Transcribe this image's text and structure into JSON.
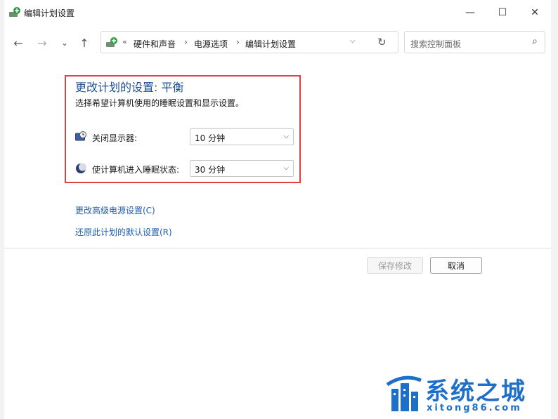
{
  "window": {
    "title": "编辑计划设置",
    "controls": {
      "minimize": "—",
      "maximize": "☐",
      "close": "✕"
    }
  },
  "nav": {
    "back": "←",
    "forward": "→",
    "recent": "⌄",
    "up": "↑",
    "address": {
      "overflow": "«",
      "crumbs": [
        "硬件和声音",
        "电源选项",
        "编辑计划设置"
      ],
      "separator": "›",
      "dropdown": "⌵",
      "refresh": "↻"
    },
    "search": {
      "placeholder": "搜索控制面板",
      "icon": "⌕"
    }
  },
  "plan": {
    "heading": "更改计划的设置: 平衡",
    "description": "选择希望计算机使用的睡眠设置和显示设置。",
    "settings": [
      {
        "icon": "display-clock-icon",
        "label": "关闭显示器:",
        "value": "10 分钟"
      },
      {
        "icon": "moon-icon",
        "label": "使计算机进入睡眠状态:",
        "value": "30 分钟"
      }
    ],
    "dropdown_arrow": "⌵"
  },
  "links": {
    "advanced": "更改高级电源设置(C)",
    "restore": "还原此计划的默认设置(R)"
  },
  "buttons": {
    "save": "保存修改",
    "cancel": "取消"
  },
  "watermark": {
    "title": "系统之城",
    "url": "xitong86.com"
  },
  "colors": {
    "heading": "#1d4f91",
    "link": "#1e5fb0",
    "highlight_border": "#e04141",
    "watermark": "#1e6fc9"
  }
}
